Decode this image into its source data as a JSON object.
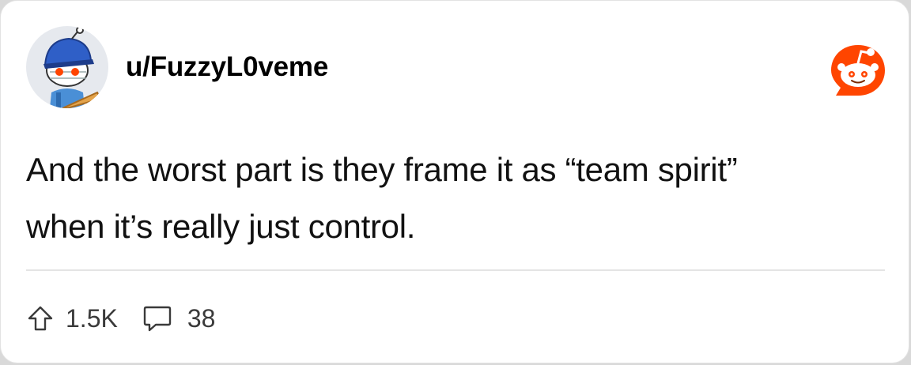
{
  "post": {
    "username": "u/FuzzyL0veme",
    "text_line_1": "And the worst part is they frame it as “team spirit”",
    "text_line_2": "when it’s really just control.",
    "upvotes": "1.5K",
    "comments": "38"
  },
  "icons": {
    "avatar": "snoo-avatar-icon",
    "brand": "reddit-logo-icon",
    "upvote": "upvote-arrow-icon",
    "comment": "comment-bubble-icon"
  },
  "colors": {
    "brand": "#ff4500",
    "text": "#111111",
    "meta": "#3a3a3a"
  }
}
